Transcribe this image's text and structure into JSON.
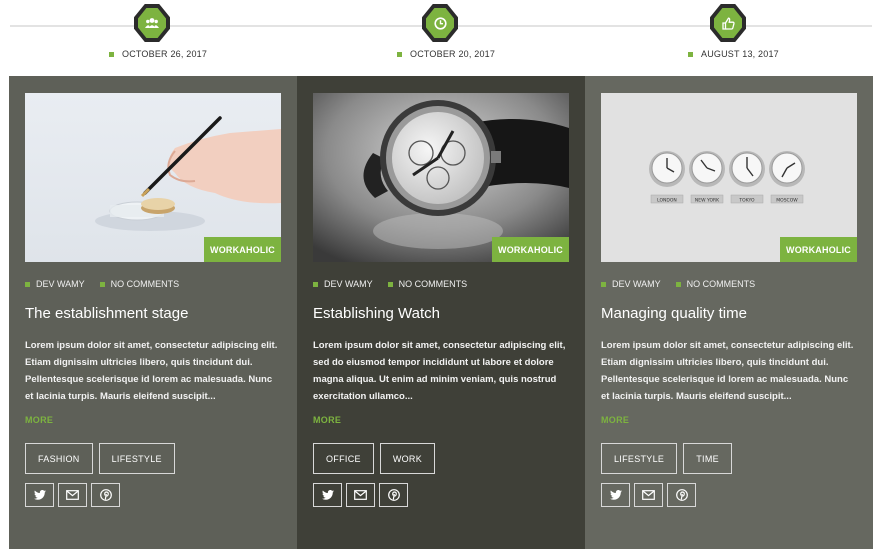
{
  "timeline": {
    "nodes": [
      {
        "icon": "users-icon",
        "date": "OCTOBER 26, 2017"
      },
      {
        "icon": "clock-icon",
        "date": "OCTOBER 20, 2017"
      },
      {
        "icon": "thumbs-up-icon",
        "date": "AUGUST 13, 2017"
      }
    ]
  },
  "colors": {
    "accent": "#7db340",
    "column_1": "#5e6058",
    "column_2": "#3f4038",
    "column_3": "#666860"
  },
  "posts": [
    {
      "category": "WORKAHOLIC",
      "author": "DEV WAMY",
      "comments": "NO COMMENTS",
      "title": "The establishment stage",
      "excerpt": "Lorem ipsum dolor sit amet, consectetur adipiscing elit. Etiam dignissim ultricies libero, quis tincidunt dui. Pellentesque scelerisque id lorem ac malesuada. Nunc et lacinia turpis. Mauris eleifend suscipit...",
      "more": "MORE",
      "tags": [
        "FASHION",
        "LIFESTYLE"
      ]
    },
    {
      "category": "WORKAHOLIC",
      "author": "DEV WAMY",
      "comments": "NO COMMENTS",
      "title": "Establishing Watch",
      "excerpt": "Lorem ipsum dolor sit amet, consectetur adipiscing elit, sed do eiusmod tempor incididunt ut labore et dolore magna aliqua. Ut enim ad minim veniam, quis nostrud exercitation ullamco...",
      "more": "MORE",
      "tags": [
        "OFFICE",
        "WORK"
      ]
    },
    {
      "category": "WORKAHOLIC",
      "author": "DEV WAMY",
      "comments": "NO COMMENTS",
      "title": "Managing quality time",
      "excerpt": "Lorem ipsum dolor sit amet, consectetur adipiscing elit. Etiam dignissim ultricies libero, quis tincidunt dui. Pellentesque scelerisque id lorem ac malesuada. Nunc et lacinia turpis. Mauris eleifend suscipit...",
      "more": "MORE",
      "tags": [
        "LIFESTYLE",
        "TIME"
      ],
      "clock_labels": [
        "LONDON",
        "NEW YORK",
        "TOKYO",
        "MOSCOW"
      ]
    }
  ],
  "share_icons": [
    "twitter-icon",
    "mail-icon",
    "pinterest-icon"
  ]
}
